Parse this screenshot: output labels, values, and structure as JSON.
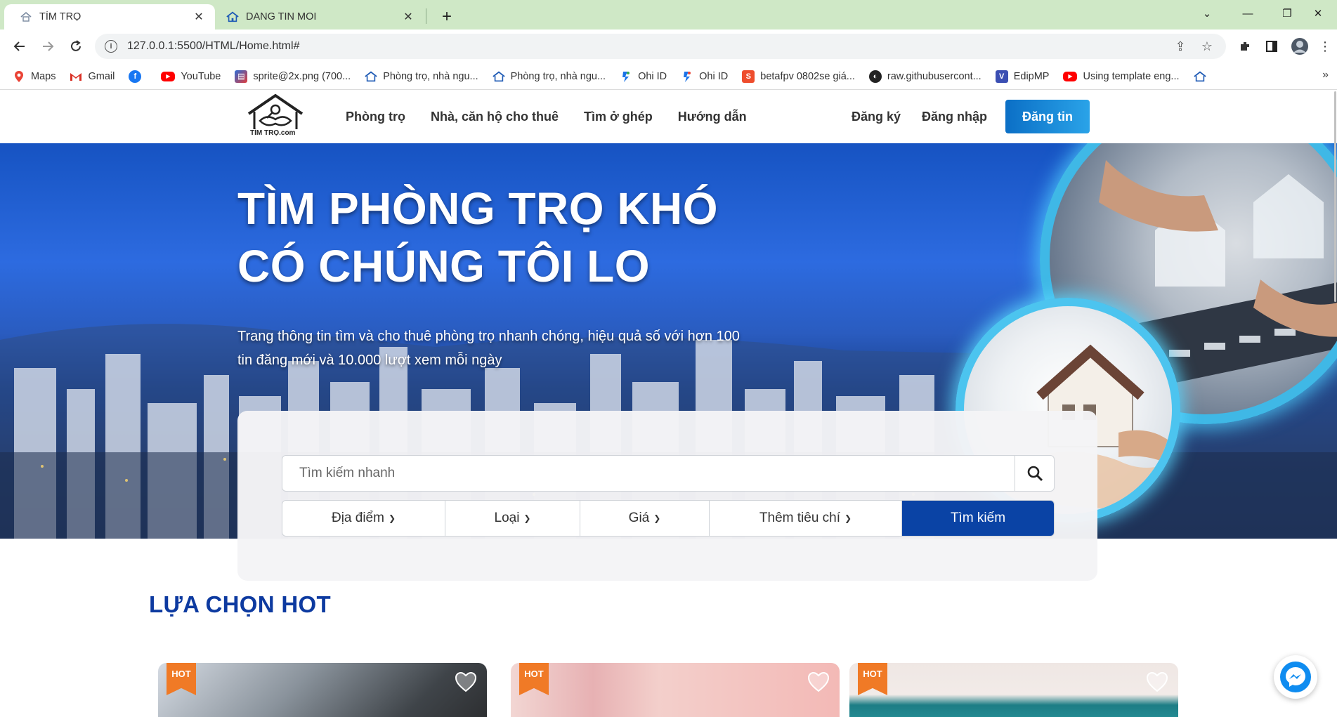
{
  "browser": {
    "tabs": [
      {
        "title": "TÌM TRỌ",
        "active": true,
        "icon": "site-favicon"
      },
      {
        "title": "DANG TIN MOI",
        "active": false,
        "icon": "house-favicon"
      }
    ],
    "url": "127.0.0.1:5500/HTML/Home.html#",
    "bookmarks": [
      {
        "label": "Maps",
        "icon": "maps-icon"
      },
      {
        "label": "Gmail",
        "icon": "gmail-icon"
      },
      {
        "label": "",
        "icon": "facebook-icon"
      },
      {
        "label": "YouTube",
        "icon": "youtube-icon"
      },
      {
        "label": "sprite@2x.png (700...",
        "icon": "image-icon"
      },
      {
        "label": "Phòng trọ, nhà ngu...",
        "icon": "house-icon"
      },
      {
        "label": "Phòng trọ, nhà ngu...",
        "icon": "house-icon"
      },
      {
        "label": "Ohi ID",
        "icon": "ohi-icon"
      },
      {
        "label": "Ohi ID",
        "icon": "ohi-icon"
      },
      {
        "label": "betafpv 0802se giá...",
        "icon": "shopee-icon"
      },
      {
        "label": "raw.githubusercont...",
        "icon": "globe-icon"
      },
      {
        "label": "EdipMP",
        "icon": "v-icon"
      },
      {
        "label": "Using template eng...",
        "icon": "youtube-icon"
      }
    ]
  },
  "site": {
    "logo_text": "TÌM TRỌ.com",
    "nav": [
      "Phòng trọ",
      "Nhà, căn hộ cho thuê",
      "Tìm ở ghép",
      "Hướng dẫn"
    ],
    "auth": {
      "register": "Đăng ký",
      "login": "Đăng nhập"
    },
    "post_button": "Đăng tin",
    "colors": {
      "primary": "#0a43a5",
      "accent": "#1e8ad9",
      "hot": "#f07a26",
      "title": "#0d3aa0"
    }
  },
  "hero": {
    "title_line1": "TÌM PHÒNG TRỌ KHÓ",
    "title_line2": "CÓ CHÚNG TÔI LO",
    "subtitle": "Trang thông tin tìm và cho thuê phòng trọ nhanh chóng, hiệu quả số với hơn 100 tin đăng mới và 10.000 lượt xem mỗi ngày"
  },
  "search": {
    "placeholder": "Tìm kiếm nhanh",
    "filters": [
      "Địa điểm",
      "Loại",
      "Giá",
      "Thêm tiêu chí"
    ],
    "submit": "Tìm kiếm"
  },
  "hot_section": {
    "title": "LỰA CHỌN HOT",
    "cards": [
      {
        "badge": "HOT"
      },
      {
        "badge": "HOT"
      },
      {
        "badge": "HOT"
      }
    ]
  }
}
